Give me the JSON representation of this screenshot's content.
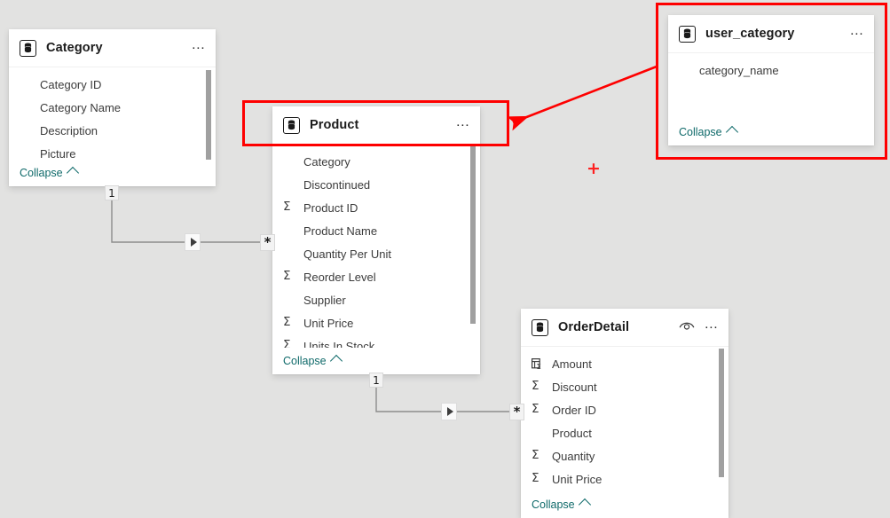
{
  "canvas": {
    "background": "#e2e2e1",
    "accent_red": "#fe0000",
    "link_color": "#0f6a6a",
    "plus_marker": "+"
  },
  "tables": [
    {
      "id": "category",
      "name": "Category",
      "icon": "table-icon",
      "menu": "…",
      "hidden_icon": null,
      "collapse_label": "Collapse",
      "fields": [
        {
          "label": "Category ID",
          "icon": "none"
        },
        {
          "label": "Category Name",
          "icon": "none"
        },
        {
          "label": "Description",
          "icon": "none"
        },
        {
          "label": "Picture",
          "icon": "none"
        }
      ]
    },
    {
      "id": "product",
      "name": "Product",
      "icon": "table-icon",
      "menu": "…",
      "hidden_icon": null,
      "collapse_label": "Collapse",
      "fields": [
        {
          "label": "Category",
          "icon": "none"
        },
        {
          "label": "Discontinued",
          "icon": "none"
        },
        {
          "label": "Product ID",
          "icon": "sigma-icon"
        },
        {
          "label": "Product Name",
          "icon": "none"
        },
        {
          "label": "Quantity Per Unit",
          "icon": "none"
        },
        {
          "label": "Reorder Level",
          "icon": "sigma-icon"
        },
        {
          "label": "Supplier",
          "icon": "none"
        },
        {
          "label": "Unit Price",
          "icon": "sigma-icon"
        },
        {
          "label": "Units In Stock",
          "icon": "sigma-icon"
        }
      ]
    },
    {
      "id": "user_category",
      "name": "user_category",
      "icon": "table-icon",
      "menu": "…",
      "hidden_icon": null,
      "collapse_label": "Collapse",
      "fields": [
        {
          "label": "category_name",
          "icon": "none"
        }
      ]
    },
    {
      "id": "orderdetail",
      "name": "OrderDetail",
      "icon": "table-icon",
      "menu": "…",
      "hidden_icon": "eye-icon",
      "collapse_label": "Collapse",
      "fields": [
        {
          "label": "Amount",
          "icon": "measure-icon"
        },
        {
          "label": "Discount",
          "icon": "sigma-icon"
        },
        {
          "label": "Order ID",
          "icon": "sigma-icon"
        },
        {
          "label": "Product",
          "icon": "none"
        },
        {
          "label": "Quantity",
          "icon": "sigma-icon"
        },
        {
          "label": "Unit Price",
          "icon": "sigma-icon"
        }
      ]
    }
  ],
  "relationships": [
    {
      "id": "category-product",
      "from_table": "Category",
      "to_table": "Product",
      "from_cardinality": "1",
      "to_cardinality": "*",
      "cross_filter": "single"
    },
    {
      "id": "product-orderdetail",
      "from_table": "Product",
      "to_table": "OrderDetail",
      "from_cardinality": "1",
      "to_cardinality": "*",
      "cross_filter": "single"
    }
  ],
  "annotations": {
    "highlight_product_header": true,
    "highlight_user_category": true,
    "arrow_from": "user_category",
    "arrow_to": "Product"
  }
}
